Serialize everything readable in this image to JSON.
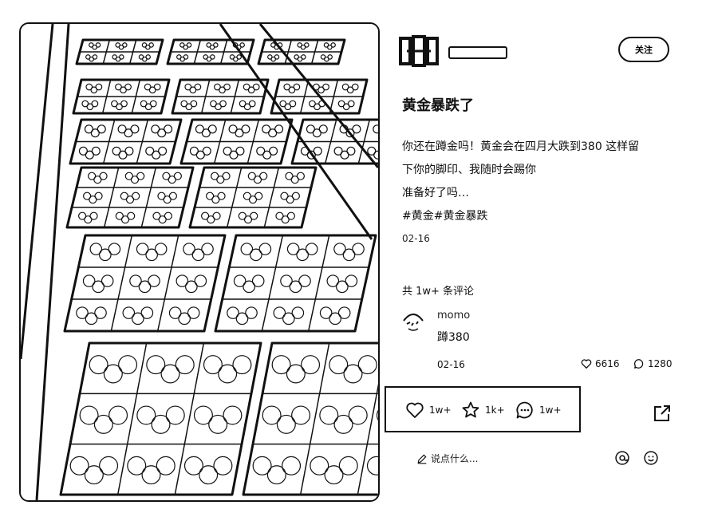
{
  "post": {
    "title": "黄金暴跌了",
    "body_lines": [
      "你还在蹲金吗！黄金会在四月大跌到380 这样留",
      "下你的脚印、我随时会踢你",
      "准备好了吗…"
    ],
    "hashtags": "#黄金#黄金暴跌",
    "date": "02-16"
  },
  "author": {
    "follow_label": "关注"
  },
  "comments": {
    "count_text": "共 1w+ 条评论",
    "items": [
      {
        "user": "momo",
        "text": "蹲380",
        "date": "02-16",
        "likes": "6616",
        "replies": "1280"
      }
    ]
  },
  "actions": {
    "like_count": "1w+",
    "star_count": "1k+",
    "comment_count": "1w+"
  },
  "composer": {
    "placeholder": "说点什么..."
  },
  "icons": [
    "heart-icon",
    "star-icon",
    "comment-icon",
    "share-icon",
    "pencil-icon",
    "at-icon",
    "emoji-icon"
  ]
}
